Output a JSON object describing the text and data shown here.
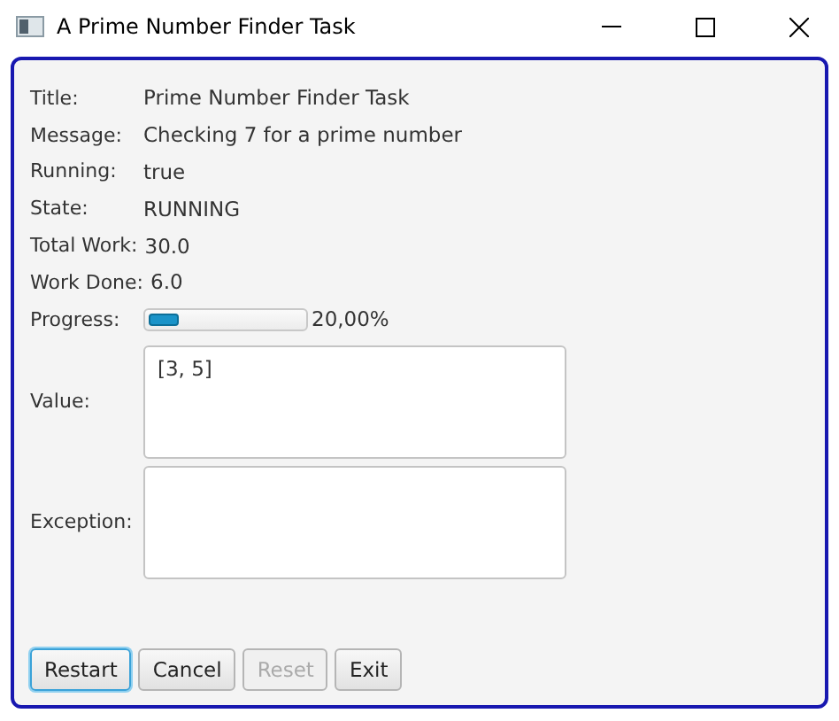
{
  "window": {
    "title": "A Prime Number Finder Task"
  },
  "fields": [
    {
      "label": "Title:",
      "value": "Prime Number Finder Task"
    },
    {
      "label": "Message:",
      "value": "Checking 7 for a prime number"
    },
    {
      "label": "Running:",
      "value": "true"
    },
    {
      "label": "State:",
      "value": "RUNNING"
    },
    {
      "label": "Total Work:",
      "value": "30.0"
    },
    {
      "label": "Work Done:",
      "value": "6.0"
    }
  ],
  "progress": {
    "label": "Progress:",
    "level": 0.2,
    "reading": "20,00%"
  },
  "text_areas": [
    {
      "label": "Value:",
      "value": "[3, 5]"
    },
    {
      "label": "Exception:"
    }
  ],
  "buttons": [
    {
      "label": "Restart",
      "focused": true,
      "disabled": false
    },
    {
      "label": "Cancel",
      "focused": false,
      "disabled": false
    },
    {
      "label": "Reset",
      "focused": false,
      "disabled": true
    },
    {
      "label": "Exit",
      "focused": false,
      "disabled": false
    }
  ]
}
